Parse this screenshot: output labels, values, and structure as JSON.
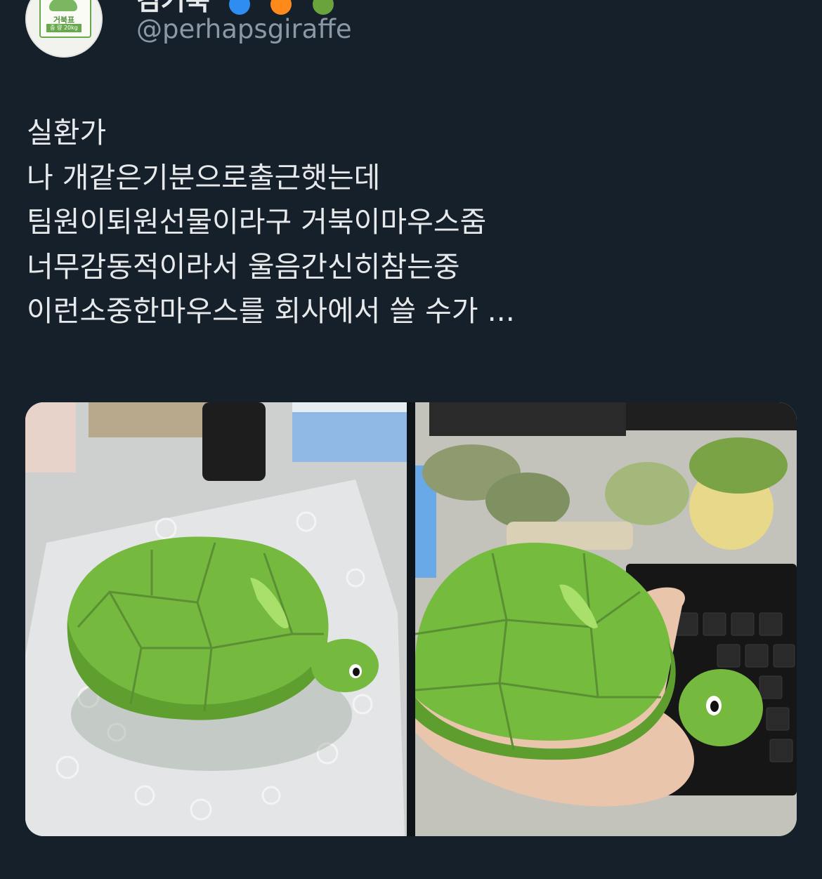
{
  "author": {
    "display_name": "김거북",
    "handle": "@perhapsgiraffe",
    "name_icons": [
      "water-drop-icon",
      "fire-icon",
      "turtle-icon"
    ],
    "avatar": {
      "badge_name": "거북표",
      "badge_sub": "중 량 20kg"
    }
  },
  "tweet": {
    "lines": [
      "실환가",
      "나 개같은기분으로출근햇는데",
      "팀원이퇴원선물이라구 거북이마우스줌",
      "너무감동적이라서 울음간신히참는중",
      "이런소중한마우스를 회사에서 쓸 수가 ..."
    ]
  },
  "media": {
    "photos": [
      {
        "name": "turtle-mouse-on-bubble-wrap"
      },
      {
        "name": "turtle-mouse-in-hand-on-desk"
      }
    ]
  },
  "colors": {
    "background": "#15202b",
    "text": "#e7e9ea",
    "secondary_text": "#8b98a5",
    "turtle_green": "#7cc142"
  }
}
